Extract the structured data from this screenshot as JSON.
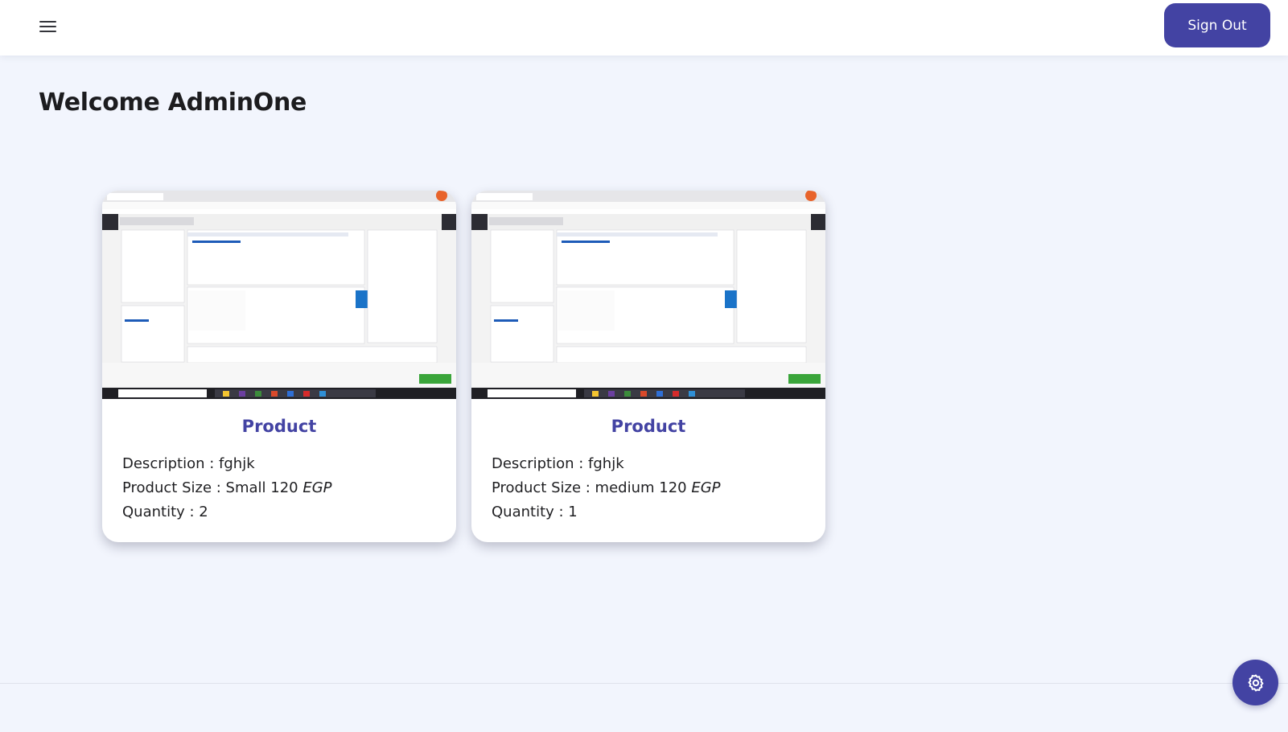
{
  "header": {
    "menu_icon": "hamburger-menu-icon",
    "signout_label": "Sign Out"
  },
  "page": {
    "title": "Welcome AdminOne"
  },
  "products": [
    {
      "title": "Product",
      "description_label": "Description : ",
      "description": "fghjk",
      "size_label": "Product Size : ",
      "size": "Small",
      "price": "120",
      "currency": "EGP",
      "quantity_label": "Quantity : ",
      "quantity": "2",
      "image_icon": "screenshot-thumbnail"
    },
    {
      "title": "Product",
      "description_label": "Description : ",
      "description": "fghjk",
      "size_label": "Product Size : ",
      "size": "medium",
      "price": "120",
      "currency": "EGP",
      "quantity_label": "Quantity : ",
      "quantity": "1",
      "image_icon": "screenshot-thumbnail"
    }
  ],
  "settings_fab": {
    "icon": "gear-icon"
  },
  "colors": {
    "accent": "#4343a3",
    "background": "#f2f5fd",
    "card": "#ffffff"
  }
}
